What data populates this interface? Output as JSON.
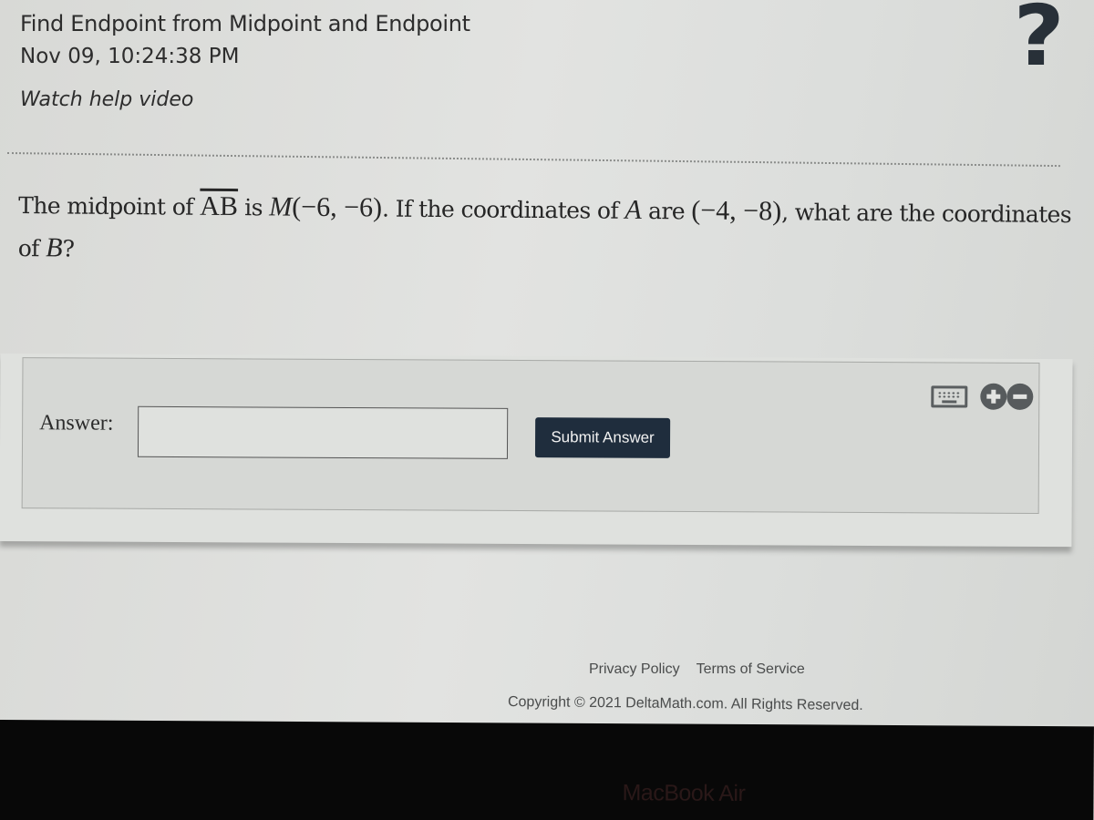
{
  "header": {
    "title": "Find Endpoint from Midpoint and Endpoint",
    "timestamp": "Nov 09, 10:24:38 PM",
    "help_link": "Watch help video",
    "help_icon": "?"
  },
  "question": {
    "part1": "The midpoint of ",
    "segment": "AB",
    "part2": " is ",
    "midpoint_label": "M",
    "midpoint_coords": "(−6, −6)",
    "part3": ". If the coordinates of ",
    "point_a_label": "A",
    "part4": " are ",
    "point_a_coords": "(−4, −8)",
    "part5": ", what are the coordinates of ",
    "point_b_label": "B",
    "part6": "?"
  },
  "answer": {
    "label": "Answer:",
    "value": "",
    "placeholder": "",
    "submit_label": "Submit Answer"
  },
  "tools": {
    "keyboard_icon": "keyboard-icon",
    "zoom_in_icon": "plus-circle-icon",
    "zoom_out_icon": "minus-circle-icon"
  },
  "footer": {
    "privacy": "Privacy Policy",
    "terms": "Terms of Service",
    "copyright": "Copyright © 2021 DeltaMath.com. All Rights Reserved."
  },
  "device": {
    "label": "MacBook Air"
  }
}
